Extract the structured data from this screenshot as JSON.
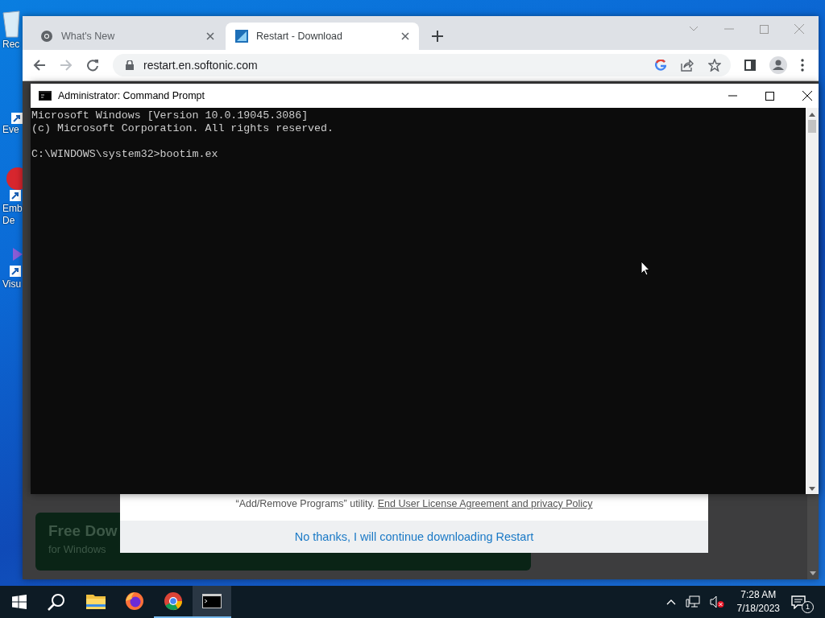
{
  "desktop": {
    "icons": [
      {
        "kind": "recycle",
        "lines": [
          "Rec"
        ]
      },
      {
        "kind": "shortcut",
        "lines": [
          "Eve"
        ]
      },
      {
        "kind": "red",
        "lines": [
          "Emb",
          "De"
        ]
      },
      {
        "kind": "purple",
        "lines": [
          "Visu"
        ]
      }
    ]
  },
  "browser": {
    "tabs": [
      {
        "title": "What's New",
        "selected": false
      },
      {
        "title": "Restart - Download",
        "selected": true
      }
    ],
    "url": "restart.en.softonic.com",
    "page": {
      "banner": {
        "title": "Free Dow",
        "subtitle": "for Windows"
      },
      "dialog": {
        "text": "“Add/Remove Programs” utility.",
        "link": "End User License Agreement and privacy Policy",
        "decline": "No thanks, I will continue downloading Restart"
      }
    }
  },
  "console": {
    "title": "Administrator:  Command Prompt",
    "lines": [
      "Microsoft Windows [Version 10.0.19045.3086]",
      "(c) Microsoft Corporation. All rights reserved."
    ],
    "prompt": "C:\\WINDOWS\\system32>bootim.ex"
  },
  "taskbar": {
    "apps": [
      {
        "kind": "explorer",
        "running": false,
        "active": false
      },
      {
        "kind": "firefox",
        "running": false,
        "active": false
      },
      {
        "kind": "chrome",
        "running": true,
        "active": false
      },
      {
        "kind": "terminal",
        "running": true,
        "active": true
      }
    ],
    "time": "7:28 AM",
    "date": "7/18/2023",
    "notifications": "1"
  }
}
